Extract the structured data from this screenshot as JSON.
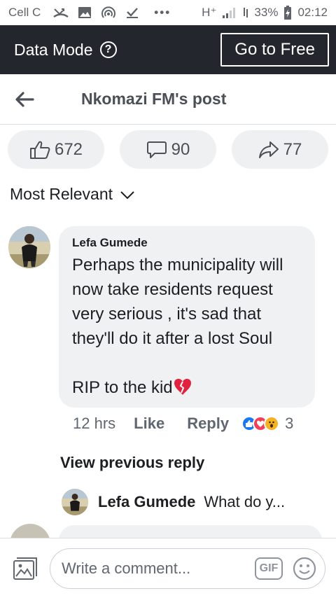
{
  "status_bar": {
    "carrier": "Cell C",
    "network": "H⁺",
    "battery": "33%",
    "time": "02:12",
    "dots": "•••"
  },
  "data_bar": {
    "label": "Data Mode",
    "help_icon": "?",
    "go_free_label": "Go to Free"
  },
  "header": {
    "title": "Nkomazi FM's post"
  },
  "reactions": {
    "likes": "672",
    "comments": "90",
    "shares": "77"
  },
  "sort_label": "Most Relevant",
  "comment": {
    "author": "Lefa Gumede",
    "text": "Perhaps the municipality will now take residents request very serious , it's sad that they'll  do it after a lost Soul\n\nRIP to the kid",
    "time": "12 hrs",
    "like_label": "Like",
    "reply_label": "Reply",
    "reaction_count": "3"
  },
  "view_previous_reply": "View previous reply",
  "reply_preview": {
    "author": "Lefa Gumede",
    "text": "What do y..."
  },
  "composer": {
    "placeholder": "Write a comment...",
    "gif_label": "GIF"
  },
  "colors": {
    "dark_bar": "#23272d",
    "pill_bg": "#eff0f2",
    "bubble_bg": "#f0f1f3",
    "like_blue": "#1877f2",
    "love_red": "#f33e58",
    "wow_yellow": "#f7b125"
  }
}
